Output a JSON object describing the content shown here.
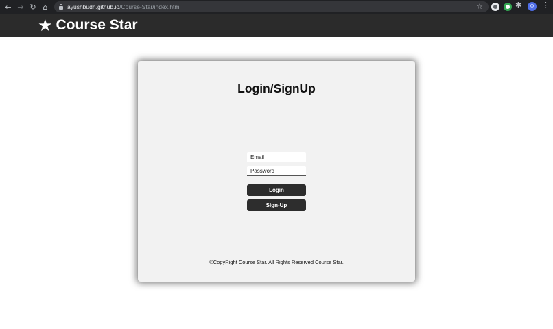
{
  "browser": {
    "url_host": "ayushbudh.github.io",
    "url_path": "/Course-Star/index.html",
    "icons": [
      "back-arrow-icon",
      "forward-arrow-icon",
      "reload-icon",
      "home-icon",
      "lock-icon",
      "bookmark-star-icon",
      "extension-icon",
      "grammarly-icon",
      "puzzle-icon",
      "profile-avatar-icon",
      "kebab-menu-icon"
    ]
  },
  "header": {
    "star_glyph": "★",
    "brand": "Course Star"
  },
  "login_card": {
    "title": "Login/SignUp",
    "email_placeholder": "Email",
    "password_placeholder": "Password",
    "login_label": "Login",
    "signup_label": "Sign-Up",
    "footer": "©CopyRight Course Star. All Rights Reserved Course Star."
  },
  "colors": {
    "header_bg": "#2b2b2b",
    "card_bg": "#f2f2f2",
    "button_bg": "#2d2d2d",
    "browser_bg": "#202124"
  }
}
